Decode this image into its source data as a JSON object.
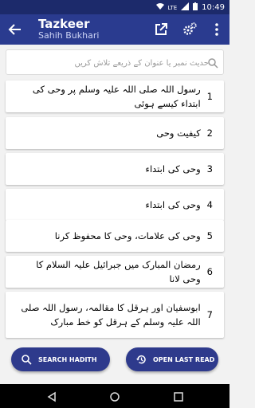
{
  "status": {
    "sim_label": "LTE",
    "time": "10:49"
  },
  "header": {
    "title": "Tazkeer",
    "subtitle": "Sahih Bukhari"
  },
  "search": {
    "placeholder": "حدیث نمبر یا عنوان کے ذریعے تلاش کریں"
  },
  "items": [
    {
      "num": "1",
      "text": "رسول اللہ صلی اللہ علیہ وسلم پر وحی کی ابتداء کیسے ہوئی"
    },
    {
      "num": "2",
      "text": "کیفیت وحی"
    },
    {
      "num": "3",
      "text": "وحی کی ابتداء"
    },
    {
      "num": "4",
      "text": "وحی کی ابتداء"
    },
    {
      "num": "5",
      "text": "وحی کی علامات، وحی کا محفوظ کرنا"
    },
    {
      "num": "6",
      "text": "رمضان المبارک میں جبرائیل علیہ السلام کا وحی لانا"
    },
    {
      "num": "7",
      "text": "ابوسفیان اور ہرقل کا مقالمہ، رسول اللہ صلی اللہ علیہ وسلم کے ہرقل کو خط مبارک"
    }
  ],
  "buttons": {
    "search": "SEARCH HADITH",
    "open_last": "OPEN LAST READ"
  },
  "colors": {
    "primary": "#2a3b8f",
    "status": "#1c2a6b",
    "button": "#2e3a8c"
  }
}
